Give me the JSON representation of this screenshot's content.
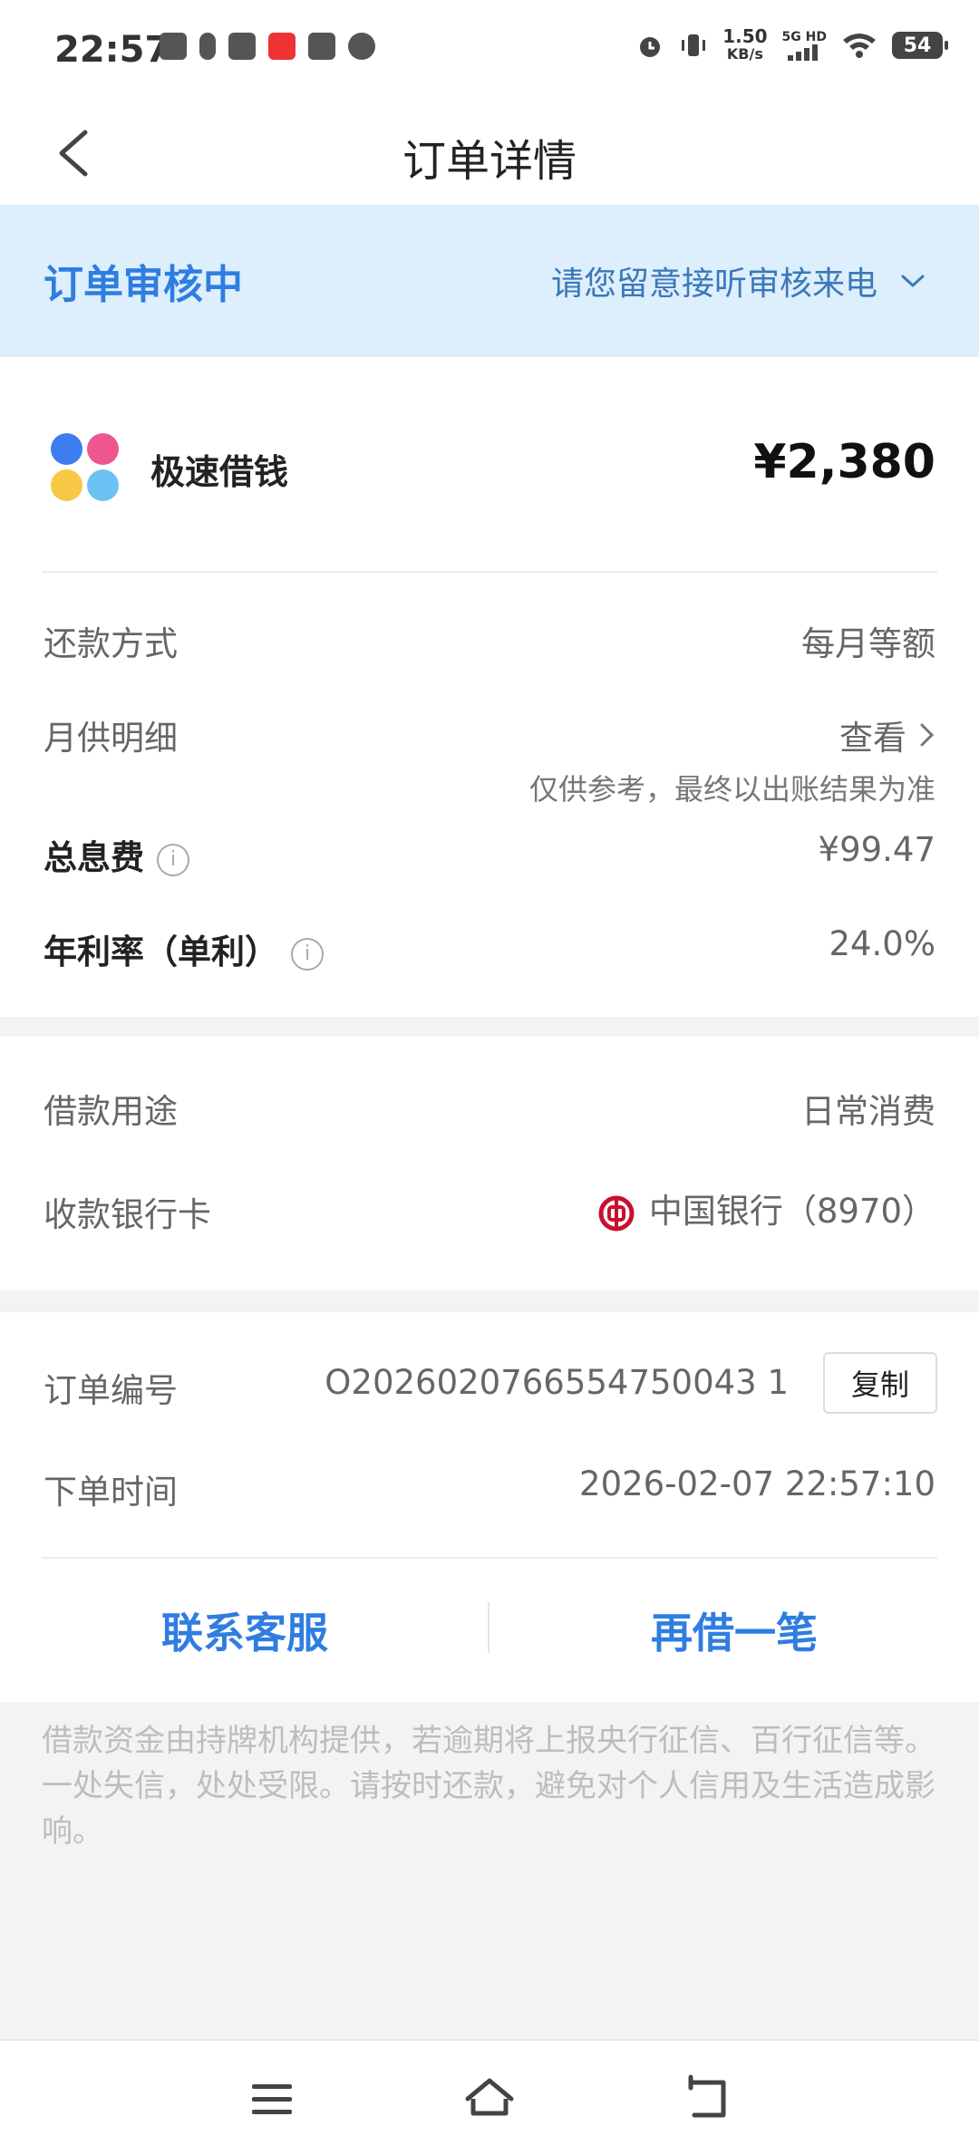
{
  "status_bar": {
    "time": "22:57",
    "net_speed_value": "1.50",
    "net_speed_unit": "KB/s",
    "network_label": "5G HD",
    "battery": "54"
  },
  "nav": {
    "title": "订单详情"
  },
  "banner": {
    "status": "订单审核中",
    "hint": "请您留意接听审核来电"
  },
  "product": {
    "name": "极速借钱",
    "amount": "¥2,380"
  },
  "details": {
    "repay_method_label": "还款方式",
    "repay_method_value": "每月等额",
    "monthly_label": "月供明细",
    "monthly_link": "查看",
    "monthly_note": "仅供参考，最终以出账结果为准",
    "interest_label": "总息费",
    "interest_value": "¥99.47",
    "rate_label": "年利率（单利）",
    "rate_value": "24.0%"
  },
  "usage": {
    "purpose_label": "借款用途",
    "purpose_value": "日常消费",
    "card_label": "收款银行卡",
    "card_value": "中国银行（8970）"
  },
  "order": {
    "id_label": "订单编号",
    "id_value": "O2026020766554750043 1",
    "copy_label": "复制",
    "time_label": "下单时间",
    "time_value": "2026-02-07 22:57:10"
  },
  "actions": {
    "contact": "联系客服",
    "borrow_again": "再借一笔"
  },
  "disclaimer": "借款资金由持牌机构提供，若逾期将上报央行征信、百行征信等。一处失信，处处受限。请按时还款，避免对个人信用及生活造成影响。",
  "colors": {
    "accent": "#2f7de1",
    "banner_bg": "#ddeefc",
    "bank_red": "#c8102e"
  }
}
